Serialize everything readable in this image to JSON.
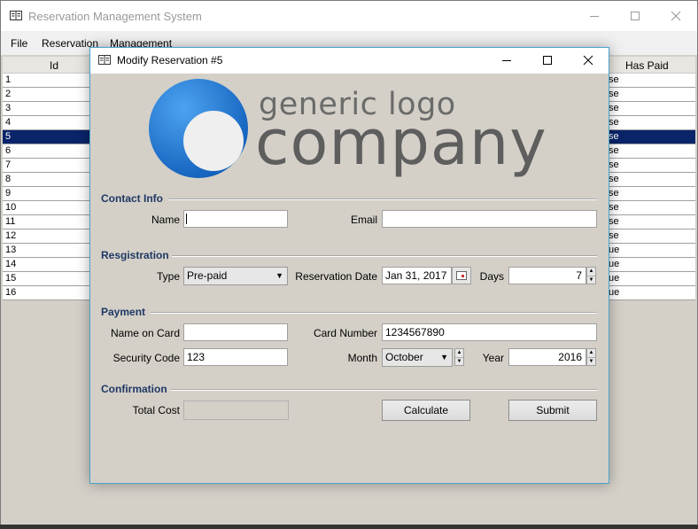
{
  "main": {
    "title": "Reservation Management System",
    "menu": [
      "File",
      "Reservation",
      "Management"
    ],
    "columns": {
      "id": "Id",
      "has_paid": "Has Paid"
    },
    "rows": [
      {
        "id": "1",
        "paid": "se"
      },
      {
        "id": "2",
        "paid": "se"
      },
      {
        "id": "3",
        "paid": "se"
      },
      {
        "id": "4",
        "paid": "se"
      },
      {
        "id": "5",
        "paid": "se"
      },
      {
        "id": "6",
        "paid": "se"
      },
      {
        "id": "7",
        "paid": "se"
      },
      {
        "id": "8",
        "paid": "se"
      },
      {
        "id": "9",
        "paid": "se"
      },
      {
        "id": "10",
        "paid": "se"
      },
      {
        "id": "11",
        "paid": "se"
      },
      {
        "id": "12",
        "paid": "se"
      },
      {
        "id": "13",
        "paid": "ue"
      },
      {
        "id": "14",
        "paid": "ue"
      },
      {
        "id": "15",
        "paid": "ue"
      },
      {
        "id": "16",
        "paid": "ue"
      }
    ],
    "selected_row_index": 4
  },
  "dialog": {
    "title": "Modify Reservation #5",
    "logo": {
      "line1": "generic logo",
      "line2": "company"
    },
    "contact": {
      "heading": "Contact Info",
      "name_label": "Name",
      "name_value": "",
      "email_label": "Email",
      "email_value": ""
    },
    "registration": {
      "heading": "Resgistration",
      "type_label": "Type",
      "type_value": "Pre-paid",
      "date_label": "Reservation Date",
      "date_value": "Jan 31, 2017",
      "days_label": "Days",
      "days_value": "7"
    },
    "payment": {
      "heading": "Payment",
      "name_on_card_label": "Name on Card",
      "name_on_card_value": "",
      "card_number_label": "Card Number",
      "card_number_value": "1234567890",
      "security_code_label": "Security Code",
      "security_code_value": "123",
      "month_label": "Month",
      "month_value": "October",
      "year_label": "Year",
      "year_value": "2016"
    },
    "confirmation": {
      "heading": "Confirmation",
      "total_cost_label": "Total Cost",
      "total_cost_value": "",
      "calculate_label": "Calculate",
      "submit_label": "Submit"
    }
  },
  "colors": {
    "selected_row": "#0a246a",
    "section_heading": "#1f3864",
    "window_bg": "#d4d0c8",
    "logo_blue": "#1e6fd0",
    "logo_gray": "#6b6b6b"
  },
  "icons": [
    "app-icon",
    "minimize-icon",
    "maximize-icon",
    "close-icon",
    "calendar-icon",
    "dropdown-arrow-icon",
    "spinner-up-icon",
    "spinner-down-icon"
  ]
}
